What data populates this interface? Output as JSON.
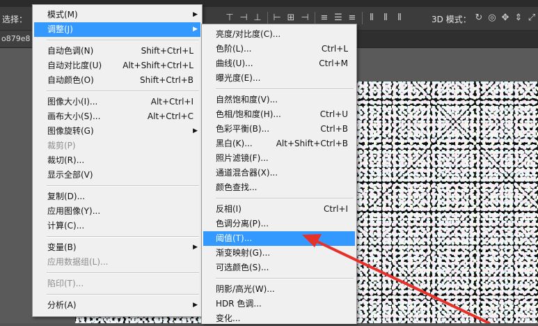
{
  "options_bar": {
    "left_label": "选择：",
    "mode3d_label": "3D 模式：",
    "align_icons": [
      "align-top-icon",
      "align-vcenter-icon",
      "align-bottom-icon",
      "separator",
      "align-left-icon",
      "align-hcenter-icon",
      "align-right-icon",
      "separator",
      "distribute-top-icon",
      "distribute-vcenter-icon",
      "distribute-bottom-icon",
      "separator",
      "distribute-left-icon",
      "distribute-hcenter-icon",
      "distribute-right-icon"
    ],
    "mode3d_icons": [
      "3d-rotate-icon",
      "3d-roll-icon",
      "3d-drag-icon",
      "3d-slide-icon",
      "3d-scale-icon"
    ]
  },
  "document_tab": {
    "label": "o879e8"
  },
  "main_menu": {
    "items": [
      {
        "label": "模式(M)",
        "shortcut": "",
        "submenu": true,
        "disabled": false,
        "highlighted": false
      },
      {
        "label": "调整(J)",
        "shortcut": "",
        "submenu": true,
        "disabled": false,
        "highlighted": true
      },
      {
        "separator": true
      },
      {
        "label": "自动色调(N)",
        "shortcut": "Shift+Ctrl+L",
        "submenu": false,
        "disabled": false
      },
      {
        "label": "自动对比度(U)",
        "shortcut": "Alt+Shift+Ctrl+L",
        "submenu": false,
        "disabled": false
      },
      {
        "label": "自动颜色(O)",
        "shortcut": "Shift+Ctrl+B",
        "submenu": false,
        "disabled": false
      },
      {
        "separator": true
      },
      {
        "label": "图像大小(I)...",
        "shortcut": "Alt+Ctrl+I",
        "submenu": false,
        "disabled": false
      },
      {
        "label": "画布大小(S)...",
        "shortcut": "Alt+Ctrl+C",
        "submenu": false,
        "disabled": false
      },
      {
        "label": "图像旋转(G)",
        "shortcut": "",
        "submenu": true,
        "disabled": false
      },
      {
        "label": "裁剪(P)",
        "shortcut": "",
        "submenu": false,
        "disabled": true
      },
      {
        "label": "裁切(R)...",
        "shortcut": "",
        "submenu": false,
        "disabled": false
      },
      {
        "label": "显示全部(V)",
        "shortcut": "",
        "submenu": false,
        "disabled": false
      },
      {
        "separator": true
      },
      {
        "label": "复制(D)...",
        "shortcut": "",
        "submenu": false,
        "disabled": false
      },
      {
        "label": "应用图像(Y)...",
        "shortcut": "",
        "submenu": false,
        "disabled": false
      },
      {
        "label": "计算(C)...",
        "shortcut": "",
        "submenu": false,
        "disabled": false
      },
      {
        "separator": true
      },
      {
        "label": "变量(B)",
        "shortcut": "",
        "submenu": true,
        "disabled": false
      },
      {
        "label": "应用数据组(L)...",
        "shortcut": "",
        "submenu": false,
        "disabled": true
      },
      {
        "separator": true
      },
      {
        "label": "陷印(T)...",
        "shortcut": "",
        "submenu": false,
        "disabled": true
      },
      {
        "separator": true
      },
      {
        "label": "分析(A)",
        "shortcut": "",
        "submenu": true,
        "disabled": false
      }
    ]
  },
  "adjust_submenu": {
    "items": [
      {
        "label": "亮度/对比度(C)...",
        "shortcut": ""
      },
      {
        "label": "色阶(L)...",
        "shortcut": "Ctrl+L"
      },
      {
        "label": "曲线(U)...",
        "shortcut": "Ctrl+M"
      },
      {
        "label": "曝光度(E)...",
        "shortcut": ""
      },
      {
        "separator": true
      },
      {
        "label": "自然饱和度(V)...",
        "shortcut": ""
      },
      {
        "label": "色相/饱和度(H)...",
        "shortcut": "Ctrl+U"
      },
      {
        "label": "色彩平衡(B)...",
        "shortcut": "Ctrl+B"
      },
      {
        "label": "黑白(K)...",
        "shortcut": "Alt+Shift+Ctrl+B"
      },
      {
        "label": "照片滤镜(F)...",
        "shortcut": ""
      },
      {
        "label": "通道混合器(X)...",
        "shortcut": ""
      },
      {
        "label": "颜色查找...",
        "shortcut": ""
      },
      {
        "separator": true
      },
      {
        "label": "反相(I)",
        "shortcut": "Ctrl+I"
      },
      {
        "label": "色调分离(P)...",
        "shortcut": ""
      },
      {
        "label": "阈值(T)...",
        "shortcut": "",
        "highlighted": true
      },
      {
        "label": "渐变映射(G)...",
        "shortcut": ""
      },
      {
        "label": "可选颜色(S)...",
        "shortcut": ""
      },
      {
        "separator": true
      },
      {
        "label": "阴影/高光(W)...",
        "shortcut": ""
      },
      {
        "label": "HDR 色调...",
        "shortcut": ""
      },
      {
        "label": "变化...",
        "shortcut": ""
      }
    ]
  },
  "colors": {
    "highlight": "#3399ff",
    "menu_bg": "#f0f0f0",
    "annotation_arrow": "#e8302a"
  }
}
